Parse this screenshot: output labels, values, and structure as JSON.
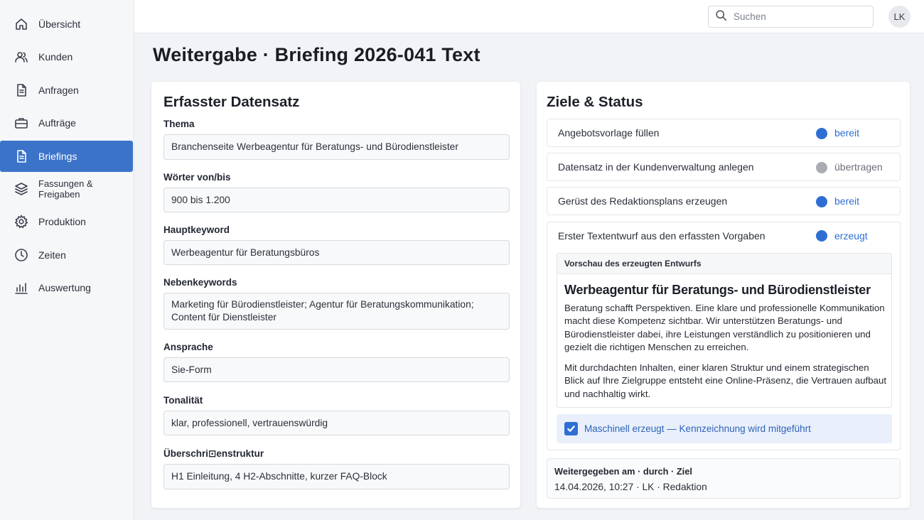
{
  "sidebar": {
    "items": [
      {
        "label": "Übersicht",
        "icon": "home-icon"
      },
      {
        "label": "Kunden",
        "icon": "users-icon"
      },
      {
        "label": "Anfragen",
        "icon": "document-icon"
      },
      {
        "label": "Aufträge",
        "icon": "briefcase-icon"
      },
      {
        "label": "Briefings",
        "icon": "document-icon",
        "active": true
      },
      {
        "label": "Fassungen & Freigaben",
        "icon": "layers-icon"
      },
      {
        "label": "Produktion",
        "icon": "gear-icon"
      },
      {
        "label": "Zeiten",
        "icon": "clock-icon"
      },
      {
        "label": "Auswertung",
        "icon": "bar-chart-icon"
      }
    ]
  },
  "header": {
    "search_placeholder": "Suchen",
    "avatar_initials": "LK"
  },
  "page": {
    "title": "Weitergabe · Briefing 2026-041 Text"
  },
  "record": {
    "title": "Erfasster Datensatz",
    "fields": [
      {
        "label": "Thema",
        "value": "Branchenseite Werbeagentur für Beratungs- und Bürodienstleister"
      },
      {
        "label": "Wörter von/bis",
        "value": "900 bis 1.200"
      },
      {
        "label": "Hauptkeyword",
        "value": "Werbeagentur für Beratungsbüros"
      },
      {
        "label": "Nebenkeywords",
        "value": "Marketing für Bürodienstleister; Agentur für Beratungskommunikation; Content für Dienstleister"
      },
      {
        "label": "Ansprache",
        "value": "Sie-Form"
      },
      {
        "label": "Tonalität",
        "value": "klar, professionell, vertrauenswürdig"
      },
      {
        "label": "Überschri⊡enstruktur",
        "value": "H1 Einleitung, 4 H2-Abschnitte, kurzer FAQ-Block"
      }
    ]
  },
  "goals": {
    "title": "Ziele & Status",
    "items": [
      {
        "label": "Angebotsvorlage füllen",
        "status": "bereit",
        "color": "#2f6fd4"
      },
      {
        "label": "Datensatz in der Kundenverwaltung anlegen",
        "status": "übertragen",
        "color": "#a9adb3"
      },
      {
        "label": "Gerüst des Redaktionsplans erzeugen",
        "status": "bereit",
        "color": "#2f6fd4"
      },
      {
        "label": "Erster Textentwurf aus den erfassten Vorgaben",
        "status": "erzeugt",
        "color": "#2f6fd4"
      }
    ],
    "preview": {
      "header": "Vorschau des erzeugten Entwurfs",
      "title": "Werbeagentur für Beratungs- und Bürodienstleister",
      "paragraph1": "Beratung schafft Perspektiven. Eine klare und professionelle Kommunikation macht diese Kompetenz sichtbar. Wir unterstützen Beratungs- und Bürodienstleister dabei, ihre Leistungen verständlich zu positionieren und gezielt die richtigen Menschen zu erreichen.",
      "paragraph2": "Mit durchdachten Inhalten, einer klaren Struktur und einem strategischen Blick auf Ihre Zielgruppe entsteht eine Online-Präsenz, die Vertrauen aufbaut und nachhaltig wirkt."
    },
    "ai_note": "Maschinell erzeugt — Kennzeichnung wird mitgeführt",
    "ai_note_checked": true,
    "handover_label": "Weitergegeben am · durch · Ziel",
    "handover_value": "14.04.2026, 10:27 · LK · Redaktion"
  }
}
